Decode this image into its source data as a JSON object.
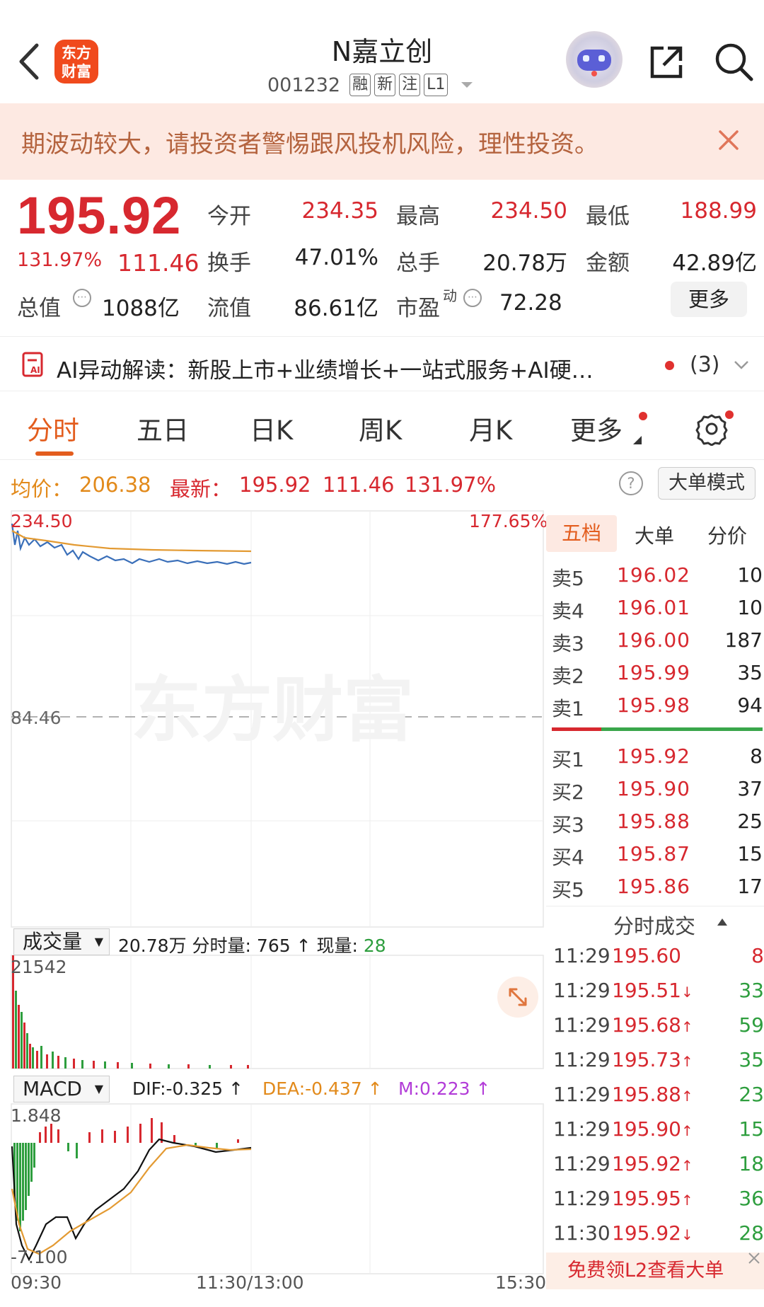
{
  "header": {
    "logo_text": "东方财富",
    "title": "N嘉立创",
    "code": "001232",
    "tags": [
      "融",
      "新",
      "注",
      "L1"
    ]
  },
  "banner": {
    "text": "期波动较大，请投资者警惕跟风投机风险，理性投资。"
  },
  "quote": {
    "price": "195.92",
    "change_pct": "131.97%",
    "change": "111.46",
    "open_label": "今开",
    "open": "234.35",
    "high_label": "最高",
    "high": "234.50",
    "low_label": "最低",
    "low": "188.99",
    "turnover_label": "换手",
    "turnover": "47.01%",
    "volume_label": "总手",
    "volume": "20.78万",
    "amount_label": "金额",
    "amount": "42.89亿",
    "mktcap_label": "总值",
    "mktcap": "1088亿",
    "float_label": "流值",
    "float": "86.61亿",
    "pe_label": "市盈",
    "pe_sup": "动",
    "pe": "72.28",
    "more": "更多"
  },
  "ai": {
    "text": "AI异动解读：新股上市+业绩增长+一站式服务+AI硬…",
    "count": "(3)"
  },
  "tabs": [
    "分时",
    "五日",
    "日K",
    "周K",
    "月K",
    "更多"
  ],
  "info": {
    "avg_label": "均价：",
    "avg": "206.38",
    "latest_label": "最新：",
    "latest": "195.92",
    "change": "111.46",
    "change_pct": "131.97%",
    "bigorder": "大单模式"
  },
  "chart": {
    "top_price": "234.50",
    "top_pct": "177.65%",
    "base_price": "84.46",
    "watermark": "东方财富",
    "vol_selector": "成交量",
    "vol_total": "20.78万",
    "vol_minute_label": "分时量:",
    "vol_minute": "765",
    "vol_now_label": "现量:",
    "vol_now": "28",
    "vol_max": "21542",
    "macd_selector": "MACD",
    "dif": "DIF:-0.325 ↑",
    "dea": "DEA:-0.437 ↑",
    "m": "M:0.223 ↑",
    "macd_max": "1.848",
    "macd_min": "-7.100",
    "time_start": "09:30",
    "time_mid": "11:30/13:00",
    "time_end": "15:30"
  },
  "book": {
    "tabs": [
      "五档",
      "大单",
      "分价"
    ],
    "asks": [
      {
        "label": "卖5",
        "price": "196.02",
        "vol": "10"
      },
      {
        "label": "卖4",
        "price": "196.01",
        "vol": "10"
      },
      {
        "label": "卖3",
        "price": "196.00",
        "vol": "187"
      },
      {
        "label": "卖2",
        "price": "195.99",
        "vol": "35"
      },
      {
        "label": "卖1",
        "price": "195.98",
        "vol": "94"
      }
    ],
    "bids": [
      {
        "label": "买1",
        "price": "195.92",
        "vol": "8"
      },
      {
        "label": "买2",
        "price": "195.90",
        "vol": "37"
      },
      {
        "label": "买3",
        "price": "195.88",
        "vol": "25"
      },
      {
        "label": "买4",
        "price": "195.87",
        "vol": "15"
      },
      {
        "label": "买5",
        "price": "195.86",
        "vol": "17"
      }
    ],
    "ticks_title": "分时成交",
    "ticks": [
      {
        "time": "11:29",
        "price": "195.60",
        "arrow": "",
        "vol": "8",
        "color": "red"
      },
      {
        "time": "11:29",
        "price": "195.51",
        "arrow": "↓",
        "vol": "33",
        "color": "green"
      },
      {
        "time": "11:29",
        "price": "195.68",
        "arrow": "↑",
        "vol": "59",
        "color": "green"
      },
      {
        "time": "11:29",
        "price": "195.73",
        "arrow": "↑",
        "vol": "35",
        "color": "green"
      },
      {
        "time": "11:29",
        "price": "195.88",
        "arrow": "↑",
        "vol": "23",
        "color": "green"
      },
      {
        "time": "11:29",
        "price": "195.90",
        "arrow": "↑",
        "vol": "15",
        "color": "green"
      },
      {
        "time": "11:29",
        "price": "195.92",
        "arrow": "↑",
        "vol": "18",
        "color": "green"
      },
      {
        "time": "11:29",
        "price": "195.95",
        "arrow": "↑",
        "vol": "36",
        "color": "green"
      },
      {
        "time": "11:30",
        "price": "195.92",
        "arrow": "↓",
        "vol": "28",
        "color": "green"
      }
    ],
    "l2": "免费领L2查看大单"
  }
}
